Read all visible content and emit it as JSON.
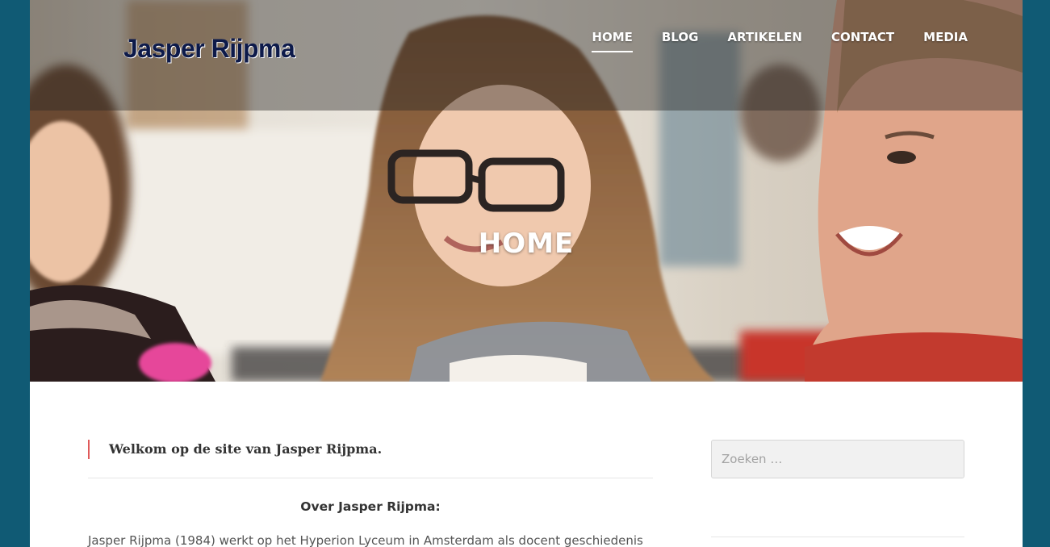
{
  "site": {
    "logo_text": "Jasper Rijpma"
  },
  "nav": {
    "items": [
      {
        "label": "HOME",
        "active": true
      },
      {
        "label": "BLOG",
        "active": false
      },
      {
        "label": "ARTIKELEN",
        "active": false
      },
      {
        "label": "CONTACT",
        "active": false
      },
      {
        "label": "MEDIA",
        "active": false
      }
    ]
  },
  "hero": {
    "title": "HOME"
  },
  "main": {
    "welcome": "Welkom op de site van Jasper Rijpma.",
    "subheading": "Over Jasper Rijpma:",
    "paragraph": "Jasper Rijpma (1984) werkt op het Hyperion Lyceum in Amsterdam als docent geschiedenis"
  },
  "sidebar": {
    "search_placeholder": "Zoeken …"
  },
  "colors": {
    "frame": "#105a74",
    "accent_border": "#e05a5a",
    "logo": "#0d1a4a"
  }
}
